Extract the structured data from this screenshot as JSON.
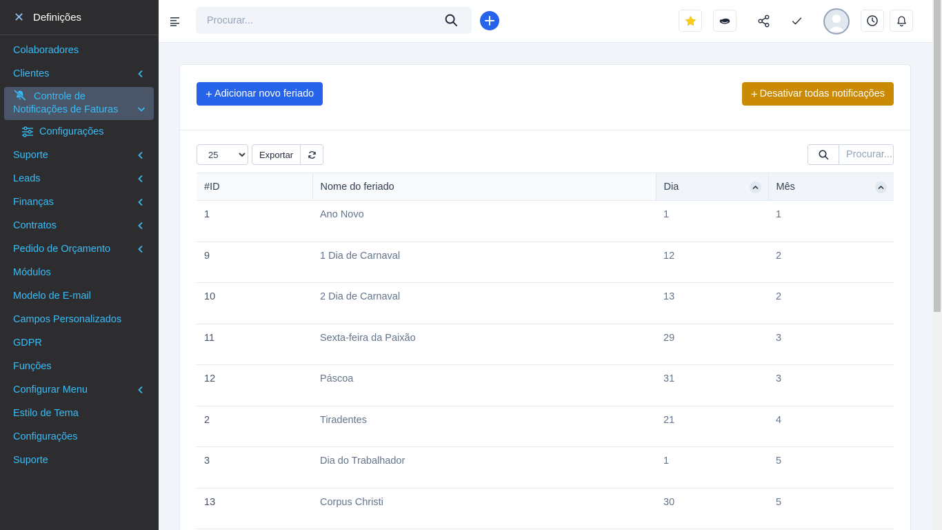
{
  "sidebar": {
    "title": "Definições",
    "items": [
      {
        "label": "Colaboradores",
        "chevron": false
      },
      {
        "label": "Clientes",
        "chevron": true
      },
      {
        "label": "Suporte",
        "chevron": true
      },
      {
        "label": "Leads",
        "chevron": true
      },
      {
        "label": "Finanças",
        "chevron": true
      },
      {
        "label": "Contratos",
        "chevron": true
      },
      {
        "label": "Pedido de Orçamento",
        "chevron": true
      },
      {
        "label": "Módulos",
        "chevron": false
      },
      {
        "label": "Modelo de E-mail",
        "chevron": false
      },
      {
        "label": "Campos Personalizados",
        "chevron": false
      },
      {
        "label": "GDPR",
        "chevron": false
      },
      {
        "label": "Funções",
        "chevron": false
      },
      {
        "label": "Configurar Menu",
        "chevron": true
      },
      {
        "label": "Estilo de Tema",
        "chevron": false
      },
      {
        "label": "Configurações",
        "chevron": false
      },
      {
        "label": "Suporte",
        "chevron": false
      }
    ],
    "active": {
      "line1": "Controle de",
      "line2": "Notificações de Faturas",
      "icon": "bell-off-icon",
      "sub_label": "Configurações",
      "sub_icon": "sliders-icon"
    }
  },
  "header": {
    "search_placeholder": "Procurar...",
    "icons": [
      "menu-icon",
      "search-icon",
      "plus-icon",
      "star-icon",
      "timer-icon",
      "share-icon",
      "check-icon",
      "avatar",
      "clock-icon",
      "bell-icon"
    ]
  },
  "page": {
    "add_button": "Adicionar novo feriado",
    "disable_button": "Desativar todas notificações",
    "page_size": "25",
    "page_size_options": [
      "25"
    ],
    "export_label": "Exportar",
    "table_search_placeholder": "Procurar...",
    "columns": [
      "#ID",
      "Nome do feriado",
      "Dia",
      "Mês"
    ],
    "rows": [
      {
        "id": "1",
        "name": "Ano Novo",
        "day": "1",
        "month": "1"
      },
      {
        "id": "9",
        "name": "1 Dia de Carnaval",
        "day": "12",
        "month": "2"
      },
      {
        "id": "10",
        "name": "2 Dia de Carnaval",
        "day": "13",
        "month": "2"
      },
      {
        "id": "11",
        "name": "Sexta-feira da Paixão",
        "day": "29",
        "month": "3"
      },
      {
        "id": "12",
        "name": "Páscoa",
        "day": "31",
        "month": "3"
      },
      {
        "id": "2",
        "name": "Tiradentes",
        "day": "21",
        "month": "4"
      },
      {
        "id": "3",
        "name": "Dia do Trabalhador",
        "day": "1",
        "month": "5"
      },
      {
        "id": "13",
        "name": "Corpus Christi",
        "day": "30",
        "month": "5"
      }
    ]
  },
  "colors": {
    "sidebar_bg": "#2d2d30",
    "link": "#38bdf8",
    "primary": "#2563eb",
    "warning": "#ca8a04"
  }
}
